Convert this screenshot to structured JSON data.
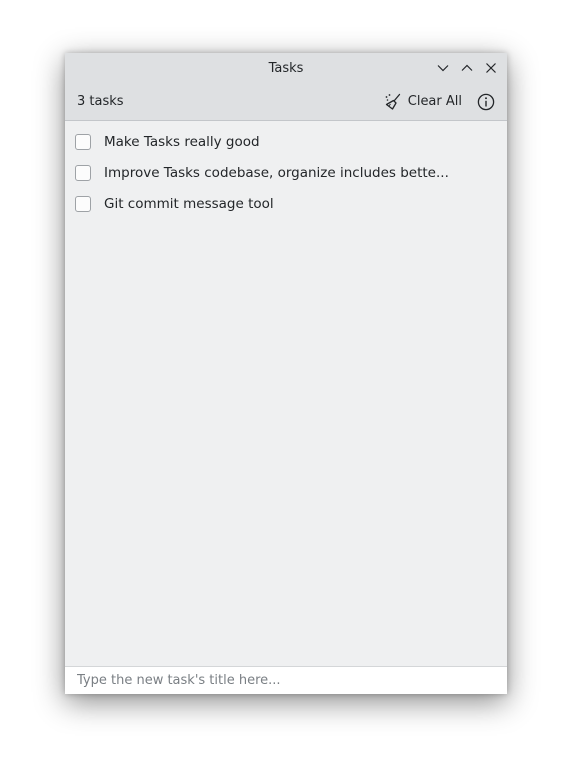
{
  "window": {
    "title": "Tasks",
    "controls": [
      "minimize-icon",
      "maximize-icon",
      "close-icon"
    ]
  },
  "toolbar": {
    "count_label": "3 tasks",
    "clear_label": "Clear All",
    "clear_icon": "broom-icon",
    "info_icon": "info-icon"
  },
  "tasks": [
    {
      "title": "Make Tasks really good",
      "done": false
    },
    {
      "title": "Improve Tasks codebase, organize includes bette...",
      "done": false
    },
    {
      "title": "Git commit message tool",
      "done": false
    }
  ],
  "new_task": {
    "placeholder": "Type the new task's title here...",
    "value": ""
  },
  "colors": {
    "background": "#eff0f1",
    "header": "#dee0e2",
    "text": "#232629"
  }
}
